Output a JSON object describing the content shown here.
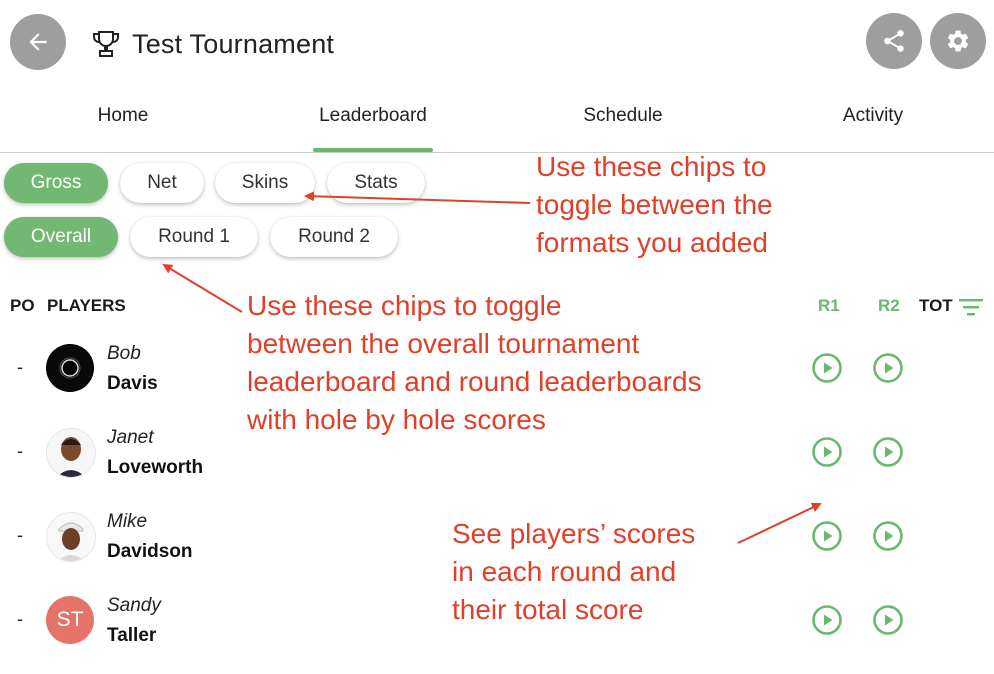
{
  "header": {
    "title": "Test Tournament",
    "back_icon": "arrow-left-icon",
    "trophy_icon": "trophy-icon",
    "share_icon": "share-icon",
    "settings_icon": "gear-icon"
  },
  "tabs": [
    {
      "label": "Home"
    },
    {
      "label": "Leaderboard",
      "selected": true
    },
    {
      "label": "Schedule"
    },
    {
      "label": "Activity"
    }
  ],
  "format_chips": [
    {
      "label": "Gross",
      "selected": true
    },
    {
      "label": "Net"
    },
    {
      "label": "Skins"
    },
    {
      "label": "Stats"
    }
  ],
  "round_chips": [
    {
      "label": "Overall",
      "selected": true
    },
    {
      "label": "Round 1"
    },
    {
      "label": "Round 2"
    }
  ],
  "table": {
    "col_pos": "PO",
    "col_players": "PLAYERS",
    "col_r1": "R1",
    "col_r2": "R2",
    "col_tot": "TOT",
    "filter_icon": "filter-list-icon",
    "rows": [
      {
        "pos": "-",
        "first": "Bob",
        "last": "Davis",
        "avatar": "photo"
      },
      {
        "pos": "-",
        "first": "Janet",
        "last": "Loveworth",
        "avatar": "photo"
      },
      {
        "pos": "-",
        "first": "Mike",
        "last": "Davidson",
        "avatar": "photo"
      },
      {
        "pos": "-",
        "first": "Sandy",
        "last": "Taller",
        "avatar": "initials",
        "initials": "ST"
      }
    ]
  },
  "annotations": {
    "formats": [
      "Use these chips to",
      "toggle between the",
      "formats you added"
    ],
    "rounds": [
      "Use these chips to toggle",
      "between the overall tournament",
      "leaderboard and round leaderboards",
      "with hole by hole scores"
    ],
    "scores": [
      "See players’ scores",
      "in each round and",
      "their total score"
    ]
  },
  "colors": {
    "accent_green": "#72b872",
    "annotation_red": "#e0402a",
    "button_gray": "#9e9e9e",
    "avatar_st": "#e57368"
  }
}
